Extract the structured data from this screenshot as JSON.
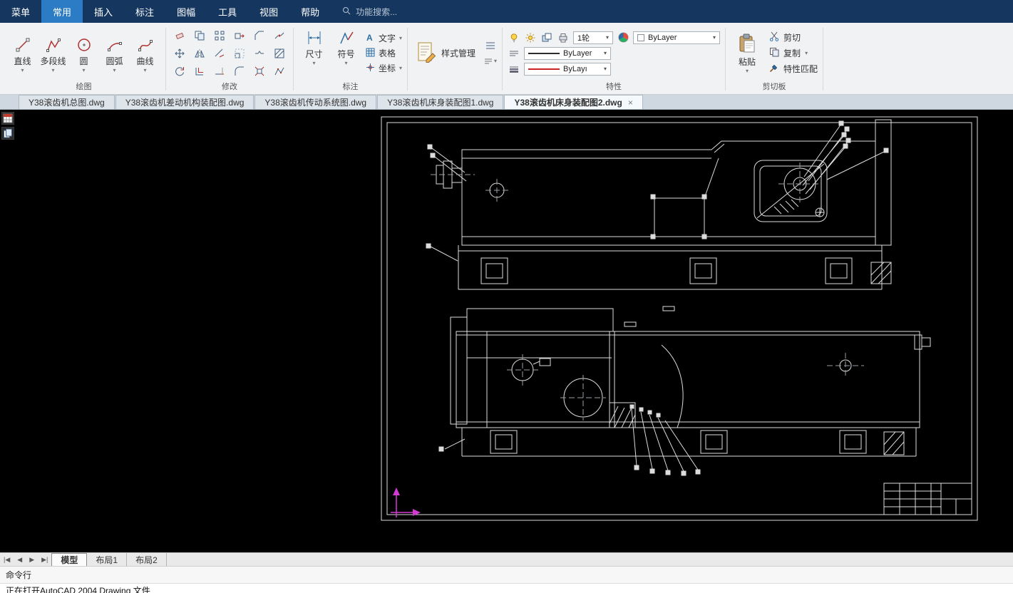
{
  "menubar": {
    "items": [
      "菜单",
      "常用",
      "插入",
      "标注",
      "图幅",
      "工具",
      "视图",
      "帮助"
    ],
    "active": "常用",
    "search_placeholder": "功能搜索..."
  },
  "ribbon": {
    "draw": {
      "label": "绘图",
      "tools": [
        "直线",
        "多段线",
        "圆",
        "圆弧",
        "曲线"
      ]
    },
    "modify": {
      "label": "修改"
    },
    "annotate": {
      "label": "标注",
      "dimension": "尺寸",
      "symbol": "符号",
      "text": "文字",
      "table": "表格",
      "coordinate": "坐标"
    },
    "style_manager": {
      "button": "样式管理"
    },
    "properties": {
      "label": "特性",
      "wheel_value": "1轮",
      "layer": "ByLayer",
      "linetype": "ByLayer",
      "lineweight": "ByLayı"
    },
    "clipboard": {
      "label": "剪切板",
      "paste": "粘贴",
      "cut": "剪切",
      "copy": "复制",
      "match": "特性匹配"
    }
  },
  "doc_tabs": {
    "tabs": [
      "Y38滚齿机总图.dwg",
      "Y38滚齿机差动机构装配图.dwg",
      "Y38滚齿机传动系统图.dwg",
      "Y38滚齿机床身装配图1.dwg",
      "Y38滚齿机床身装配图2.dwg"
    ],
    "active_index": 4,
    "close_glyph": "×"
  },
  "layout_bar": {
    "nav": [
      "|◀",
      "◀",
      "▶",
      "▶|"
    ],
    "tabs": [
      "模型",
      "布局1",
      "布局2"
    ],
    "active": "模型"
  },
  "command_line": {
    "label": "命令行"
  },
  "status_line": {
    "text": "正在打开AutoCAD 2004 Drawing 文件"
  },
  "colors": {
    "menubar": "#15365e",
    "active_tab": "#2b7cc4",
    "canvas": "#000000",
    "line": "#dcdcdc",
    "ucs": "#d23bd2"
  }
}
